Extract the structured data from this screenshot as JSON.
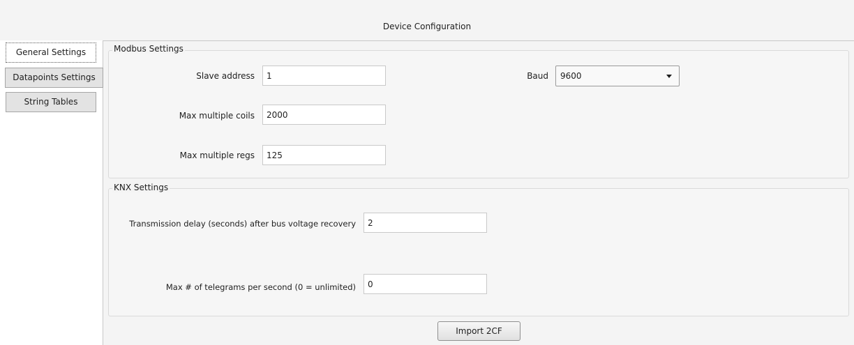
{
  "window": {
    "title": "Device Configuration"
  },
  "tabs": [
    {
      "label": "General Settings",
      "selected": true
    },
    {
      "label": "Datapoints Settings",
      "selected": false
    },
    {
      "label": "String Tables",
      "selected": false
    }
  ],
  "modbus": {
    "group_title": "Modbus Settings",
    "slave_address": {
      "label": "Slave address",
      "value": "1"
    },
    "max_multiple_coils": {
      "label": "Max multiple coils",
      "value": "2000"
    },
    "max_multiple_regs": {
      "label": "Max multiple regs",
      "value": "125"
    },
    "baud": {
      "label": "Baud",
      "value": "9600"
    }
  },
  "knx": {
    "group_title": "KNX Settings",
    "transmission_delay": {
      "label": "Transmission delay (seconds) after bus voltage recovery",
      "value": "2"
    },
    "max_telegrams": {
      "label": "Max # of telegrams per second (0 = unlimited)",
      "value": "0"
    }
  },
  "actions": {
    "import_label": "Import 2CF"
  }
}
